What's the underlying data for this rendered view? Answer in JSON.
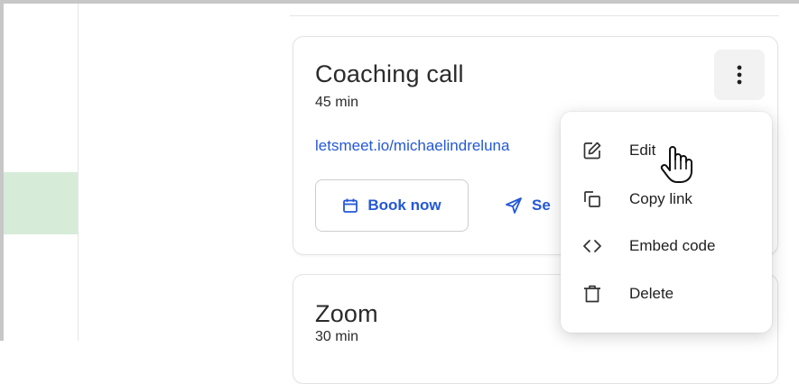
{
  "colors": {
    "accent": "#2458d6",
    "green_band": "#d7ebd9",
    "card_border": "#e3e3e3"
  },
  "cards": [
    {
      "title": "Coaching call",
      "duration": "45 min",
      "link": "letsmeet.io/michaelindreluna",
      "book_button": {
        "label": "Book now",
        "icon": "calendar-icon"
      },
      "send_button": {
        "label": "Se",
        "icon": "send-icon"
      },
      "more_icon": "kebab-menu-icon"
    },
    {
      "title": "Zoom",
      "duration": "30 min"
    }
  ],
  "context_menu": {
    "items": [
      {
        "label": "Edit",
        "icon": "edit-icon"
      },
      {
        "label": "Copy link",
        "icon": "copy-icon"
      },
      {
        "label": "Embed code",
        "icon": "code-icon"
      },
      {
        "label": "Delete",
        "icon": "trash-icon"
      }
    ]
  },
  "cursor": "hand-pointer-icon"
}
